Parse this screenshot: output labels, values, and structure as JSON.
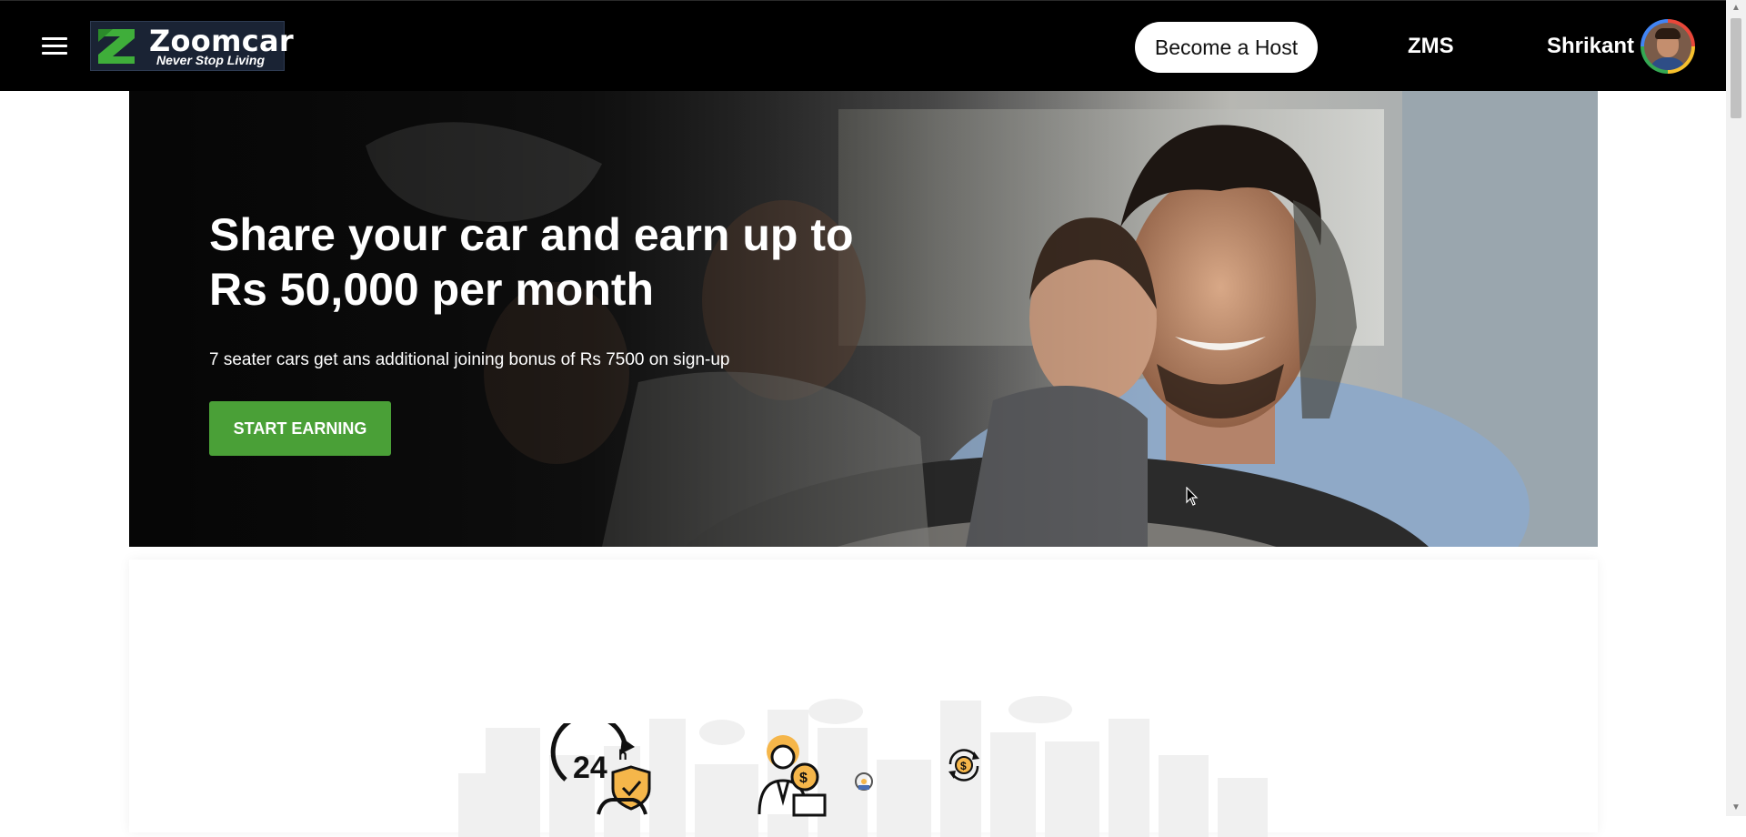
{
  "nav": {
    "brand_name": "Zoomcar",
    "brand_tagline": "Never Stop Living",
    "become_host_label": "Become a Host",
    "zms_label": "ZMS",
    "user_name": "Shrikant"
  },
  "hero": {
    "title": "Share your car and earn up to Rs 50,000 per month",
    "subtitle": "7 seater cars get ans additional joining bonus of Rs 7500 on sign-up",
    "cta_label": "START EARNING"
  },
  "features": {
    "icons": [
      "24h-protection-icon",
      "host-earnings-icon",
      "car-hub-icon",
      "money-cycle-icon"
    ],
    "hours_text": "24",
    "hours_unit": "h"
  },
  "colors": {
    "nav_bg": "#000000",
    "cta_green": "#4aa037",
    "accent_orange": "#f5b64a"
  }
}
